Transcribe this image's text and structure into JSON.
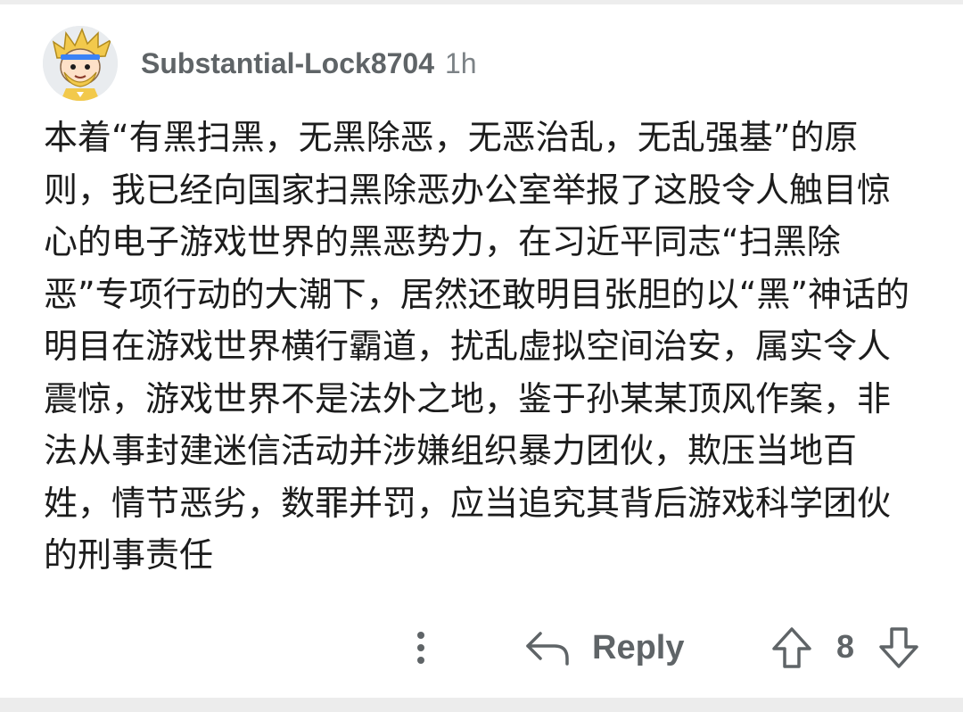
{
  "comment": {
    "author": "Substantial-Lock8704",
    "time_ago": "1h",
    "avatar_icon": "cartoon-avatar-icon",
    "body": "本着“有黑扫黑，无黑除恶，无恶治乱，无乱强基”的原则，我已经向国家扫黑除恶办公室举报了这股令人触目惊心的电子游戏世界的黑恶势力，在习近平同志“扫黑除恶”专项行动的大潮下，居然还敢明目张胆的以“黑”神话的明目在游戏世界横行霸道，扰乱虚拟空间治安，属实令人震惊，游戏世界不是法外之地，鉴于孙某某顶风作案，非法从事封建迷信活动并涉嫌组织暴力团伙，欺压当地百姓，情节恶劣，数罪并罚，应当追究其背后游戏科学团伙的刑事责任"
  },
  "actions": {
    "more_icon": "more-vertical-icon",
    "reply_icon": "reply-arrow-icon",
    "reply_label": "Reply",
    "upvote_icon": "upvote-arrow-icon",
    "vote_count": "8",
    "downvote_icon": "downvote-arrow-icon"
  },
  "colors": {
    "text_primary": "#1c1c1c",
    "text_secondary": "#5f6467",
    "avatar_background": "#e9ecef",
    "avatar_hair": "#f2c94c"
  }
}
